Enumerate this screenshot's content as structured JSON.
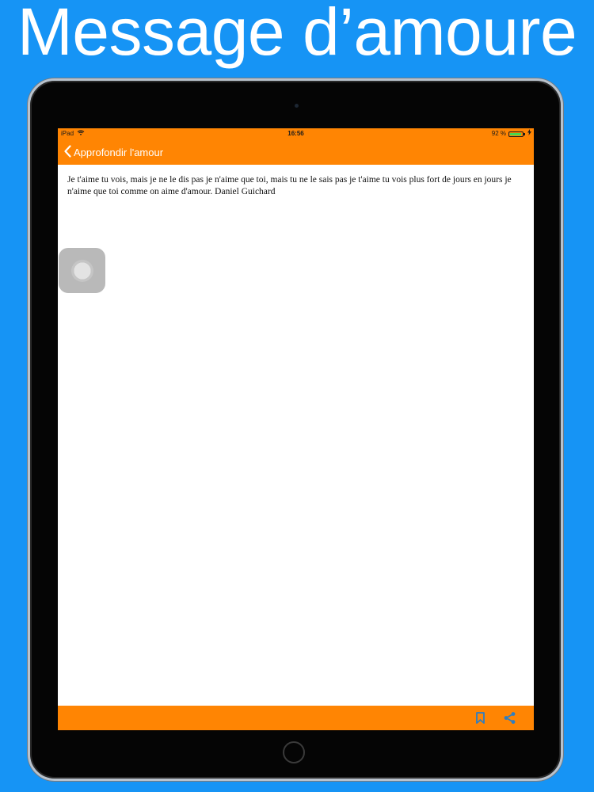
{
  "promo": {
    "title": "Message d’amoure"
  },
  "status_bar": {
    "device": "iPad",
    "time": "16:56",
    "battery_text": "92 %",
    "battery_level": 0.92
  },
  "nav": {
    "back_label": "Approfondir l'amour"
  },
  "message": {
    "text": "Je t'aime tu vois, mais je ne le dis pas je n'aime que toi, mais tu ne le sais pas je t'aime tu vois plus fort de jours en jours je n'aime que toi comme on aime d'amour. Daniel Guichard"
  },
  "icons": {
    "wifi": "wifi-icon",
    "battery": "battery-icon",
    "back": "chevron-left-icon",
    "bookmark": "bookmark-icon",
    "share": "share-icon",
    "assistive_touch": "assistive-touch-icon"
  },
  "colors": {
    "background": "#1694f5",
    "accent": "#ff8503",
    "toolbar_icon": "#2c7ec4",
    "battery": "#45d94f"
  }
}
